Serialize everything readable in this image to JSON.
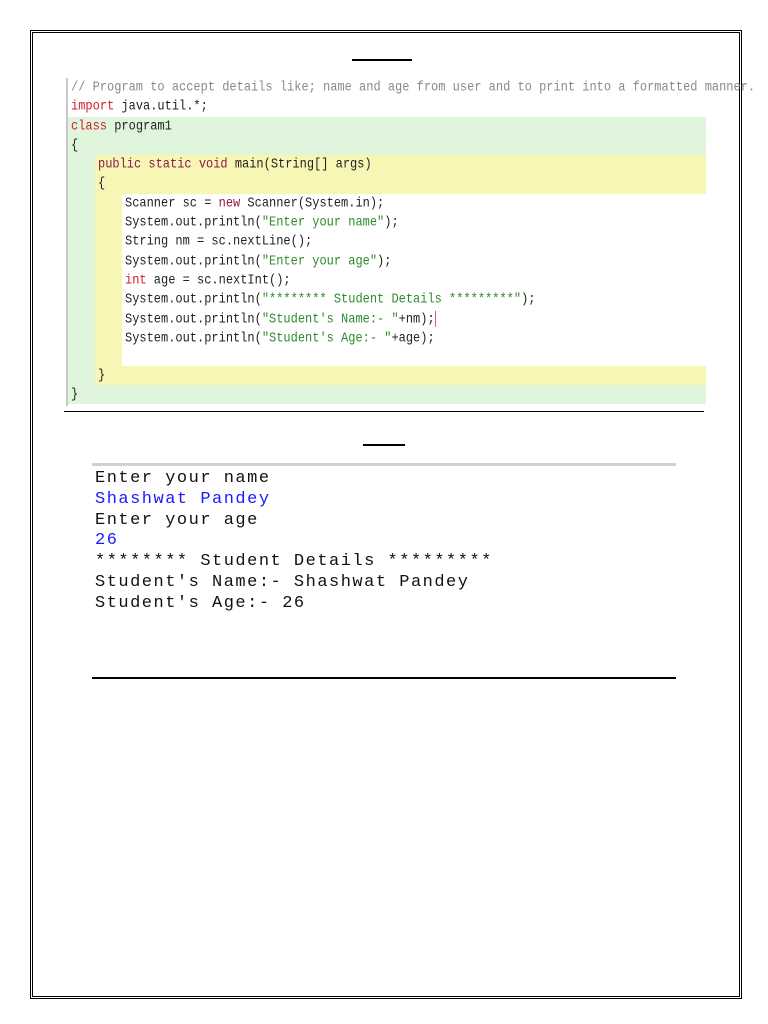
{
  "code": {
    "comment": "// Program to accept details like; name and age from user and to print into a formatted manner.",
    "import_kw": "import",
    "import_rest": " java.util.*;",
    "class_kw": "class",
    "class_name": " program1",
    "open_brace": "{",
    "close_brace": "}",
    "method_kw": "public static void",
    "method_rest": " main(String[] args)",
    "l1_a": "Scanner sc = ",
    "l1_kw": "new",
    "l1_b": " Scanner(System.in);",
    "l2_a": "System.out.println(",
    "l2_s": "\"Enter your name\"",
    "l2_b": ");",
    "l3": "String nm = sc.nextLine();",
    "l4_a": "System.out.println(",
    "l4_s": "\"Enter your age\"",
    "l4_b": ");",
    "l5_kw": "int",
    "l5_b": " age = sc.nextInt();",
    "l6_a": "System.out.println(",
    "l6_s": "\"******** Student Details *********\"",
    "l6_b": ");",
    "l7_a": "System.out.println(",
    "l7_s": "\"Student's Name:- \"",
    "l7_b": "+nm);",
    "l8_a": "System.out.println(",
    "l8_s": "\"Student's Age:- \"",
    "l8_b": "+age);"
  },
  "console": {
    "lines": [
      "Enter your name",
      "Shashwat Pandey",
      "Enter your age",
      "26",
      "******** Student Details *********",
      "Student's Name:- Shashwat Pandey",
      "Student's Age:- 26"
    ]
  }
}
